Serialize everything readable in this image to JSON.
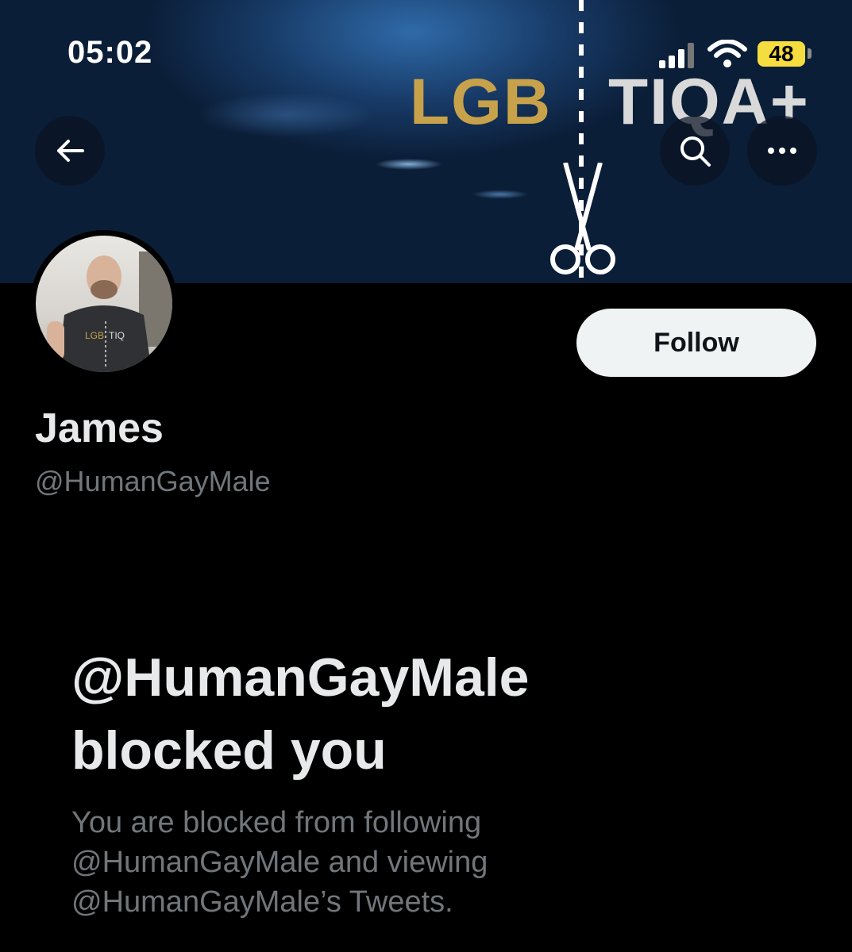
{
  "status_bar": {
    "time": "05:02",
    "battery": "48"
  },
  "banner": {
    "logo_left": "LGB",
    "logo_right": "TIQA+"
  },
  "header": {
    "back_icon": "arrow-left-icon",
    "search_icon": "search-icon",
    "more_icon": "more-horizontal-icon"
  },
  "profile": {
    "display_name": "James",
    "handle": "@HumanGayMale",
    "follow_label": "Follow",
    "avatar_shirt_left": "LGB",
    "avatar_shirt_right": "TIQ"
  },
  "blocked": {
    "title_line1": "@HumanGayMale",
    "title_line2": "blocked you",
    "body_line1": "You are blocked from following",
    "body_line2": "@HumanGayMale and viewing",
    "body_line3": "@HumanGayMale’s Tweets."
  },
  "colors": {
    "background": "#000000",
    "text": "#e7e9ea",
    "muted": "#71767b",
    "button": "#eff3f4",
    "battery": "#f5dc3f",
    "logo_gold": "#c8a24a"
  }
}
